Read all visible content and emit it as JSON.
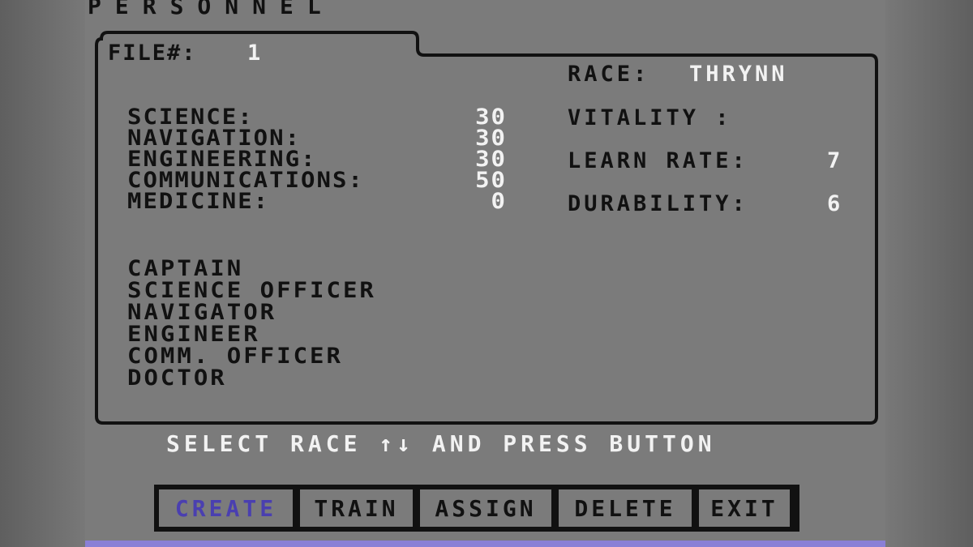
{
  "header": {
    "title": "PERSONNEL"
  },
  "file": {
    "label": "FILE#:",
    "number": "1"
  },
  "race": {
    "label": "RACE:",
    "name": "THRYNN"
  },
  "skills": [
    {
      "name": "SCIENCE:",
      "value": "30"
    },
    {
      "name": "NAVIGATION:",
      "value": "30"
    },
    {
      "name": "ENGINEERING:",
      "value": "30"
    },
    {
      "name": "COMMUNICATIONS:",
      "value": "50"
    },
    {
      "name": "MEDICINE:",
      "value": "0"
    }
  ],
  "attributes": [
    {
      "name": "VITALITY :",
      "value": ""
    },
    {
      "name": "LEARN RATE:",
      "value": "7"
    },
    {
      "name": "DURABILITY:",
      "value": "6"
    }
  ],
  "crew_positions": [
    "CAPTAIN",
    "SCIENCE OFFICER",
    "NAVIGATOR",
    "ENGINEER",
    "COMM. OFFICER",
    "DOCTOR"
  ],
  "instruction": "SELECT RACE ↑↓ AND PRESS BUTTON",
  "menu": {
    "items": [
      "CREATE",
      "TRAIN",
      "ASSIGN",
      "DELETE",
      "EXIT"
    ],
    "selected": "CREATE"
  },
  "colors": {
    "background": "#7b7b7b",
    "text_dark": "#111111",
    "text_light": "#f2f2f2",
    "selected_menu": "#4a3fb0",
    "bottom_bar": "#8a80d6"
  }
}
